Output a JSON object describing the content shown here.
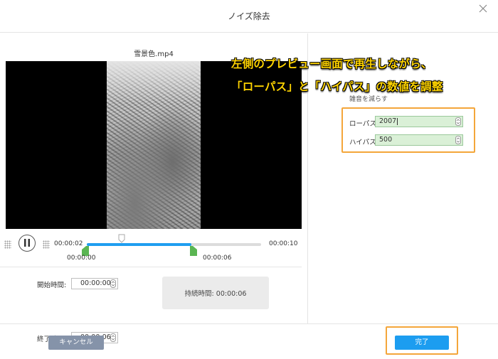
{
  "dialog": {
    "title": "ノイズ除去"
  },
  "annotation": {
    "line1": "左側のプレビュー画面で再生しながら、",
    "line2": "「ローパス」と「ハイパス」の数値を調整"
  },
  "preview": {
    "filename": "雪景色.mp4",
    "current_time": "00:00:02",
    "total_time": "00:00:10",
    "range_start_label": "00:00:00",
    "range_end_label": "00:00:06",
    "selected_range_fraction": [
      0.0,
      0.6
    ],
    "playhead_fraction": 0.2
  },
  "trim": {
    "start_label": "開始時間:",
    "start_value": "00:00:00",
    "end_label": "終了時間:",
    "end_value": "00:00:06",
    "duration_label": "持続時間:",
    "duration_value": "00:00:06"
  },
  "noise": {
    "section_title": "雑音を減らす",
    "lowpass_label": "ローパス",
    "lowpass_value": "2007",
    "highpass_label": "ハイパス",
    "highpass_value": "500"
  },
  "footer": {
    "cancel_label": "キャンセル",
    "done_label": "完了"
  },
  "colors": {
    "accent": "#1c9df0",
    "highlight": "#f4a63a",
    "handle": "#5ab552",
    "cancel": "#8593a9",
    "annotation": "#ffd400"
  }
}
